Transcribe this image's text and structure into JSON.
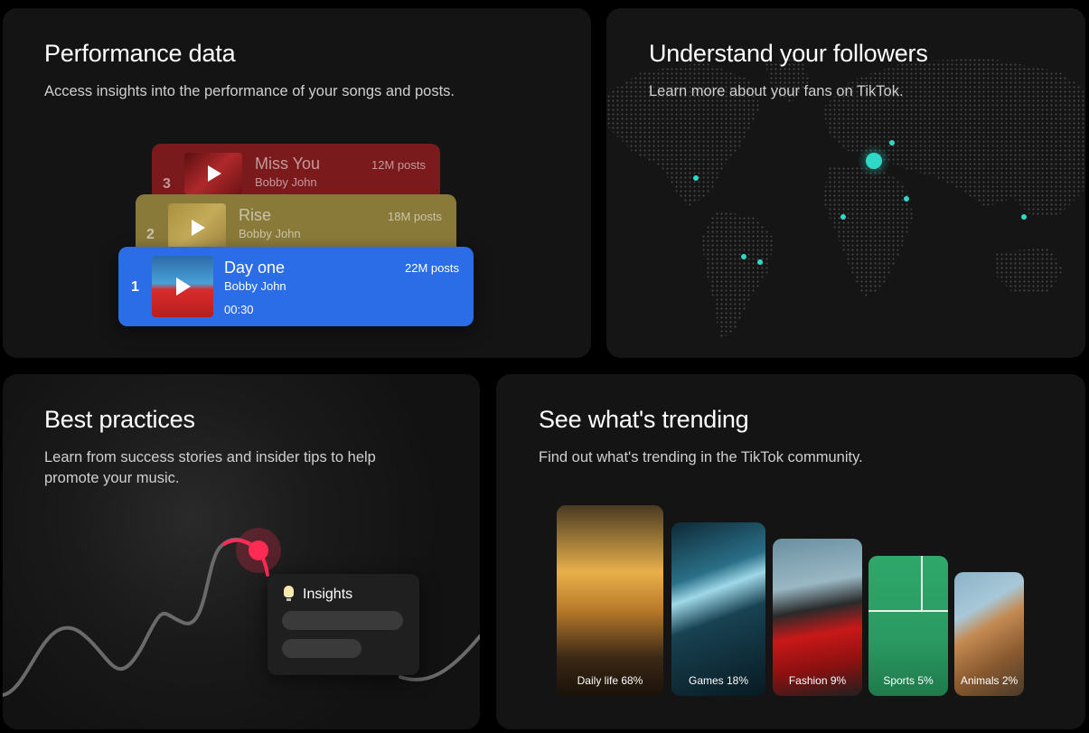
{
  "performance": {
    "title": "Performance data",
    "subtitle": "Access insights into the performance of your songs and posts.",
    "songs": [
      {
        "rank": "1",
        "title": "Day one",
        "artist": "Bobby John",
        "posts": "22M posts",
        "duration": "00:30"
      },
      {
        "rank": "2",
        "title": "Rise",
        "artist": "Bobby John",
        "posts": "18M posts"
      },
      {
        "rank": "3",
        "title": "Miss You",
        "artist": "Bobby John",
        "posts": "12M posts"
      }
    ]
  },
  "followers": {
    "title": "Understand your followers",
    "subtitle": "Learn more about your fans on TikTok."
  },
  "practices": {
    "title": "Best practices",
    "subtitle_line1": "Learn from success stories and insider tips to help",
    "subtitle_line2": "promote your music.",
    "insights_label": "Insights"
  },
  "trending": {
    "title": "See what's trending",
    "subtitle": "Find out what's trending in the TikTok community.",
    "categories": [
      {
        "label": "Daily life 68%"
      },
      {
        "label": "Games 18%"
      },
      {
        "label": "Fashion 9%"
      },
      {
        "label": "Sports 5%"
      },
      {
        "label": "Animals 2%"
      }
    ]
  },
  "colors": {
    "accent_blue": "#2a6de6",
    "accent_pink": "#fe2c55",
    "map_dot": "#2fd9c8"
  }
}
